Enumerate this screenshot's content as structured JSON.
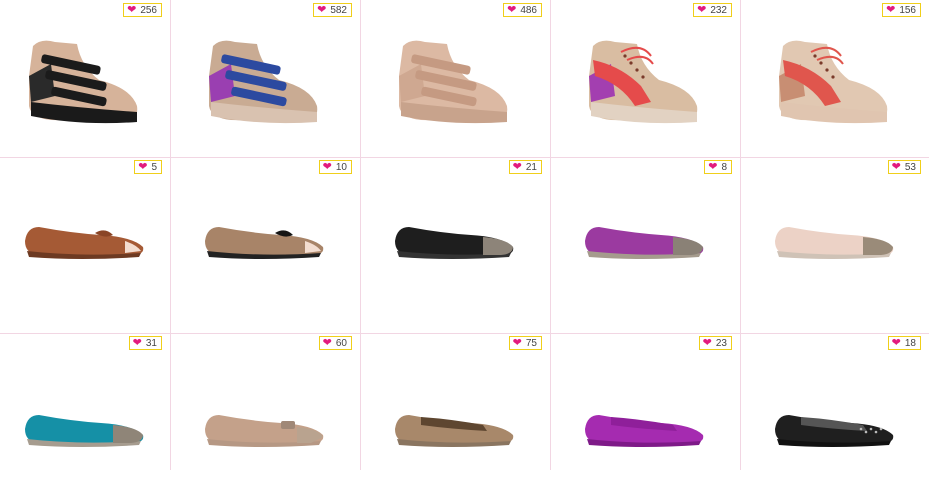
{
  "products": [
    {
      "likes": "256",
      "kind": "sneaker",
      "main": "#d6b39a",
      "accent": "#1b1b1b",
      "second": "#2a2a2a",
      "sole": "#1a1a1a",
      "icon": "wedge-sneaker-black-beige"
    },
    {
      "likes": "582",
      "kind": "sneaker",
      "main": "#c9ab93",
      "accent": "#2c4aa0",
      "second": "#9a3fb1",
      "sole": "#d9c2b0",
      "icon": "wedge-sneaker-blue-purple"
    },
    {
      "likes": "486",
      "kind": "sneaker",
      "main": "#dcb9a3",
      "accent": "#c59a82",
      "second": "#cfa891",
      "sole": "#c8a38c",
      "icon": "wedge-sneaker-rose-gold"
    },
    {
      "likes": "232",
      "kind": "laceup",
      "main": "#d9bda2",
      "accent": "#e54b4b",
      "second": "#a33fb0",
      "sole": "#e2d2c2",
      "icon": "lace-up-sneaker-coral"
    },
    {
      "likes": "156",
      "kind": "laceup",
      "main": "#e1c8b2",
      "accent": "#e0564d",
      "second": "#c88e73",
      "sole": "#e0c5b0",
      "icon": "lace-up-sneaker-nude"
    },
    {
      "likes": "5",
      "kind": "peeptoe",
      "main": "#a55a35",
      "accent": "#8a4526",
      "second": "#7a3c22",
      "sole": "#6d3a22",
      "icon": "peep-toe-flat-brown"
    },
    {
      "likes": "10",
      "kind": "peeptoe",
      "main": "#a88468",
      "accent": "#151515",
      "second": "#5a3a26",
      "sole": "#222222",
      "icon": "peep-toe-flat-leopard"
    },
    {
      "likes": "21",
      "kind": "captoe",
      "main": "#1e1e1e",
      "accent": "#8d8479",
      "second": "#333333",
      "sole": "#333333",
      "icon": "cap-toe-flat-black"
    },
    {
      "likes": "8",
      "kind": "captoe",
      "main": "#9b3aa0",
      "accent": "#8a8176",
      "second": "#7d2d86",
      "sole": "#a59b8d",
      "icon": "cap-toe-flat-purple"
    },
    {
      "likes": "53",
      "kind": "captoe",
      "main": "#ecd2c6",
      "accent": "#9a8b79",
      "second": "#d9b9ab",
      "sole": "#cfc2b6",
      "icon": "cap-toe-flat-blush"
    },
    {
      "likes": "31",
      "kind": "captoe",
      "main": "#1590a6",
      "accent": "#8f8578",
      "second": "#0f7488",
      "sole": "#a69c8f",
      "icon": "cap-toe-flat-teal"
    },
    {
      "likes": "60",
      "kind": "bow",
      "main": "#c4a18a",
      "accent": "#a08877",
      "second": "#b48f78",
      "sole": "#b69884",
      "icon": "bow-flat-taupe"
    },
    {
      "likes": "75",
      "kind": "loafer",
      "main": "#a8886a",
      "accent": "#5e4630",
      "second": "#7e6248",
      "sole": "#8a7560",
      "icon": "loafer-leopard"
    },
    {
      "likes": "23",
      "kind": "loafer",
      "main": "#a52bb0",
      "accent": "#8f1f9a",
      "second": "#b84cc2",
      "sole": "#7e1a88",
      "icon": "loafer-purple"
    },
    {
      "likes": "18",
      "kind": "loafer",
      "main": "#1f1f1f",
      "accent": "#555555",
      "second": "#3a3a3a",
      "sole": "#111111",
      "icon": "studded-loafer-black"
    }
  ],
  "colors": {
    "heart": "#e21b7e",
    "badge_border": "#f0cf1a",
    "divider": "#f2d6e3"
  }
}
